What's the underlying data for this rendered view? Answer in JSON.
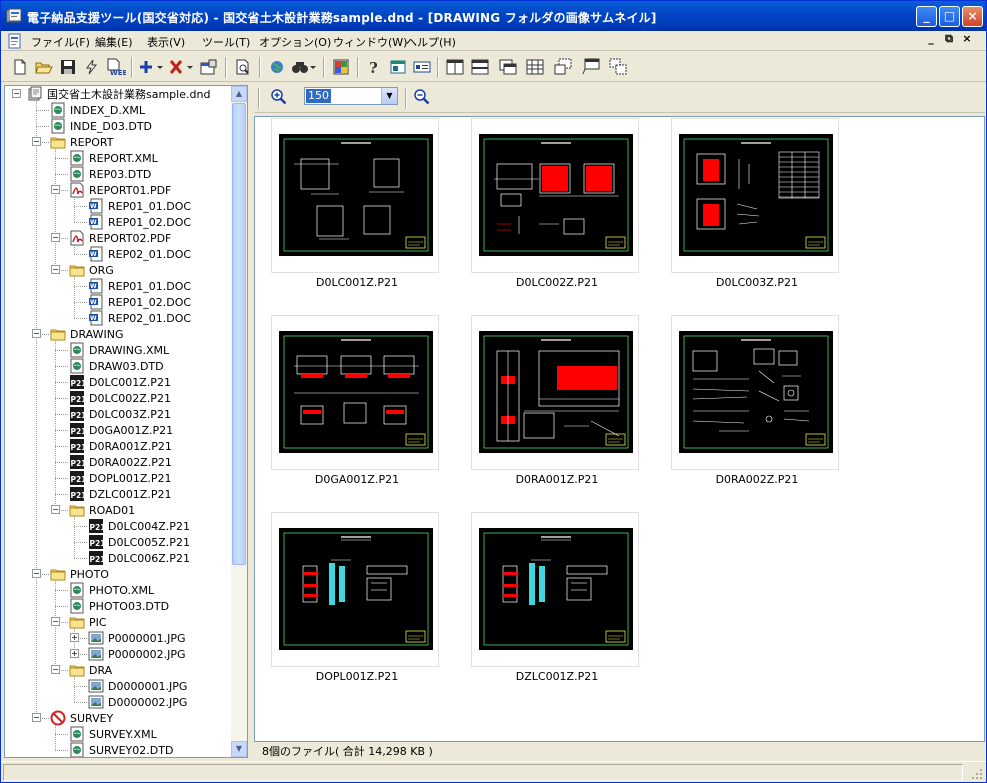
{
  "window": {
    "title": "電子納品支援ツール(国交省対応) - 国交省土木設計業務sample.dnd - [DRAWING フォルダの画像サムネイル]"
  },
  "menu": [
    {
      "label": "ファイル(F)"
    },
    {
      "label": "編集(E)"
    },
    {
      "label": "表示(V)"
    },
    {
      "label": "ツール(T)"
    },
    {
      "label": "オプション(O)"
    },
    {
      "label": "ウィンドウ(W)"
    },
    {
      "label": "ヘルプ(H)"
    }
  ],
  "mdi_controls": {
    "minimize": "_",
    "restore": "⧉",
    "close": "×"
  },
  "toolbar": [
    {
      "name": "new-icon"
    },
    {
      "name": "open-icon"
    },
    {
      "name": "save-icon"
    },
    {
      "name": "flash-icon"
    },
    {
      "name": "web-icon"
    },
    {
      "name": "add-dropdown-icon"
    },
    {
      "name": "delete-dropdown-icon"
    },
    {
      "name": "properties-icon"
    },
    {
      "name": "print-preview-icon"
    },
    {
      "name": "globe-check-icon"
    },
    {
      "name": "find-icon"
    },
    {
      "name": "color-grid-icon"
    },
    {
      "name": "help-icon"
    },
    {
      "name": "window-icon"
    },
    {
      "name": "card-icon"
    },
    {
      "name": "layout-single-icon"
    },
    {
      "name": "layout-split-h-icon"
    },
    {
      "name": "layout-cascade-icon"
    },
    {
      "name": "layout-tile-icon"
    },
    {
      "name": "layout-arrange-icon"
    },
    {
      "name": "layout-popup-icon"
    },
    {
      "name": "layout-stack-icon"
    }
  ],
  "tree": {
    "root": "国交省土木設計業務sample.dnd",
    "items": [
      {
        "label": "INDEX_D.XML",
        "icon": "xml",
        "level": 1
      },
      {
        "label": "INDE_D03.DTD",
        "icon": "xml",
        "level": 1
      },
      {
        "label": "REPORT",
        "icon": "folder",
        "level": 1,
        "expander": "−"
      },
      {
        "label": "REPORT.XML",
        "icon": "xml",
        "level": 2
      },
      {
        "label": "REP03.DTD",
        "icon": "xml",
        "level": 2
      },
      {
        "label": "REPORT01.PDF",
        "icon": "pdf",
        "level": 2,
        "expander": "−"
      },
      {
        "label": "REP01_01.DOC",
        "icon": "doc",
        "level": 3
      },
      {
        "label": "REP01_02.DOC",
        "icon": "doc",
        "level": 3
      },
      {
        "label": "REPORT02.PDF",
        "icon": "pdf",
        "level": 2,
        "expander": "−"
      },
      {
        "label": "REP02_01.DOC",
        "icon": "doc",
        "level": 3
      },
      {
        "label": "ORG",
        "icon": "folder",
        "level": 2,
        "expander": "−"
      },
      {
        "label": "REP01_01.DOC",
        "icon": "doc",
        "level": 3
      },
      {
        "label": "REP01_02.DOC",
        "icon": "doc",
        "level": 3
      },
      {
        "label": "REP02_01.DOC",
        "icon": "doc",
        "level": 3
      },
      {
        "label": "DRAWING",
        "icon": "folder",
        "level": 1,
        "expander": "−",
        "selected": true
      },
      {
        "label": "DRAWING.XML",
        "icon": "xml",
        "level": 2
      },
      {
        "label": "DRAW03.DTD",
        "icon": "xml",
        "level": 2
      },
      {
        "label": "D0LC001Z.P21",
        "icon": "p21",
        "level": 2
      },
      {
        "label": "D0LC002Z.P21",
        "icon": "p21",
        "level": 2
      },
      {
        "label": "D0LC003Z.P21",
        "icon": "p21",
        "level": 2
      },
      {
        "label": "D0GA001Z.P21",
        "icon": "p21",
        "level": 2
      },
      {
        "label": "D0RA001Z.P21",
        "icon": "p21",
        "level": 2
      },
      {
        "label": "D0RA002Z.P21",
        "icon": "p21",
        "level": 2
      },
      {
        "label": "DOPL001Z.P21",
        "icon": "p21",
        "level": 2
      },
      {
        "label": "DZLC001Z.P21",
        "icon": "p21",
        "level": 2
      },
      {
        "label": "ROAD01",
        "icon": "folder",
        "level": 2,
        "expander": "−"
      },
      {
        "label": "D0LC004Z.P21",
        "icon": "p21",
        "level": 3
      },
      {
        "label": "D0LC005Z.P21",
        "icon": "p21",
        "level": 3
      },
      {
        "label": "D0LC006Z.P21",
        "icon": "p21",
        "level": 3
      },
      {
        "label": "PHOTO",
        "icon": "folder",
        "level": 1,
        "expander": "−"
      },
      {
        "label": "PHOTO.XML",
        "icon": "xml",
        "level": 2
      },
      {
        "label": "PHOTO03.DTD",
        "icon": "xml",
        "level": 2
      },
      {
        "label": "PIC",
        "icon": "folder",
        "level": 2,
        "expander": "−"
      },
      {
        "label": "P0000001.JPG",
        "icon": "jpg",
        "level": 3,
        "expander": "+"
      },
      {
        "label": "P0000002.JPG",
        "icon": "jpg",
        "level": 3,
        "expander": "+"
      },
      {
        "label": "DRA",
        "icon": "folder",
        "level": 2,
        "expander": "−"
      },
      {
        "label": "D0000001.JPG",
        "icon": "jpg",
        "level": 3
      },
      {
        "label": "D0000002.JPG",
        "icon": "jpg",
        "level": 3
      },
      {
        "label": "SURVEY",
        "icon": "forbidden",
        "level": 1,
        "expander": "−"
      },
      {
        "label": "SURVEY.XML",
        "icon": "xml",
        "level": 2
      },
      {
        "label": "SURVEY02.DTD",
        "icon": "xml",
        "level": 2
      }
    ]
  },
  "zoom": {
    "value": "150"
  },
  "thumbnails": [
    {
      "filename": "D0LC001Z.P21",
      "variant": "a"
    },
    {
      "filename": "D0LC002Z.P21",
      "variant": "b"
    },
    {
      "filename": "D0LC003Z.P21",
      "variant": "c"
    },
    {
      "filename": "D0GA001Z.P21",
      "variant": "d"
    },
    {
      "filename": "D0RA001Z.P21",
      "variant": "e"
    },
    {
      "filename": "D0RA002Z.P21",
      "variant": "f"
    },
    {
      "filename": "DOPL001Z.P21",
      "variant": "g"
    },
    {
      "filename": "DZLC001Z.P21",
      "variant": "g"
    }
  ],
  "status": {
    "text": "8個のファイル( 合計 14,298 KB )"
  },
  "colors": {
    "titlebar": "#0A5FD8",
    "selection": "#316AC5",
    "cad_red": "#FF0000",
    "cad_background": "#000000"
  }
}
